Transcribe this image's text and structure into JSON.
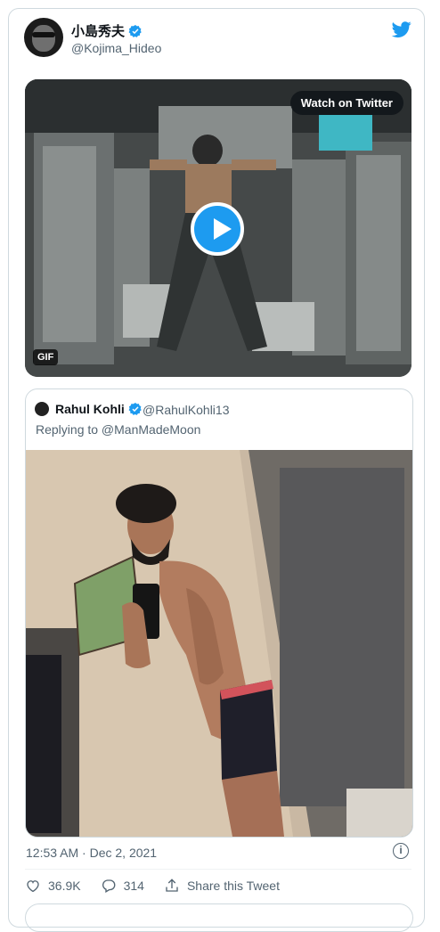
{
  "author": {
    "name": "小島秀夫",
    "handle": "@Kojima_Hideo"
  },
  "media": {
    "watch_label": "Watch on Twitter",
    "gif_label": "GIF"
  },
  "quoted": {
    "name": "Rahul Kohli",
    "handle": "@RahulKohli13",
    "reply_text": "Replying to @ManMadeMoon"
  },
  "timestamp": "12:53 AM · Dec 2, 2021",
  "info_icon": "i",
  "actions": {
    "likes": "36.9K",
    "replies": "314",
    "share_label": "Share this Tweet"
  },
  "colors": {
    "accent": "#1d9bf0",
    "muted": "#536471",
    "border": "#cfd9de"
  },
  "icons": [
    "verified-badge-icon",
    "twitter-bird-icon",
    "play-icon",
    "info-icon",
    "heart-icon",
    "reply-icon",
    "share-icon"
  ]
}
